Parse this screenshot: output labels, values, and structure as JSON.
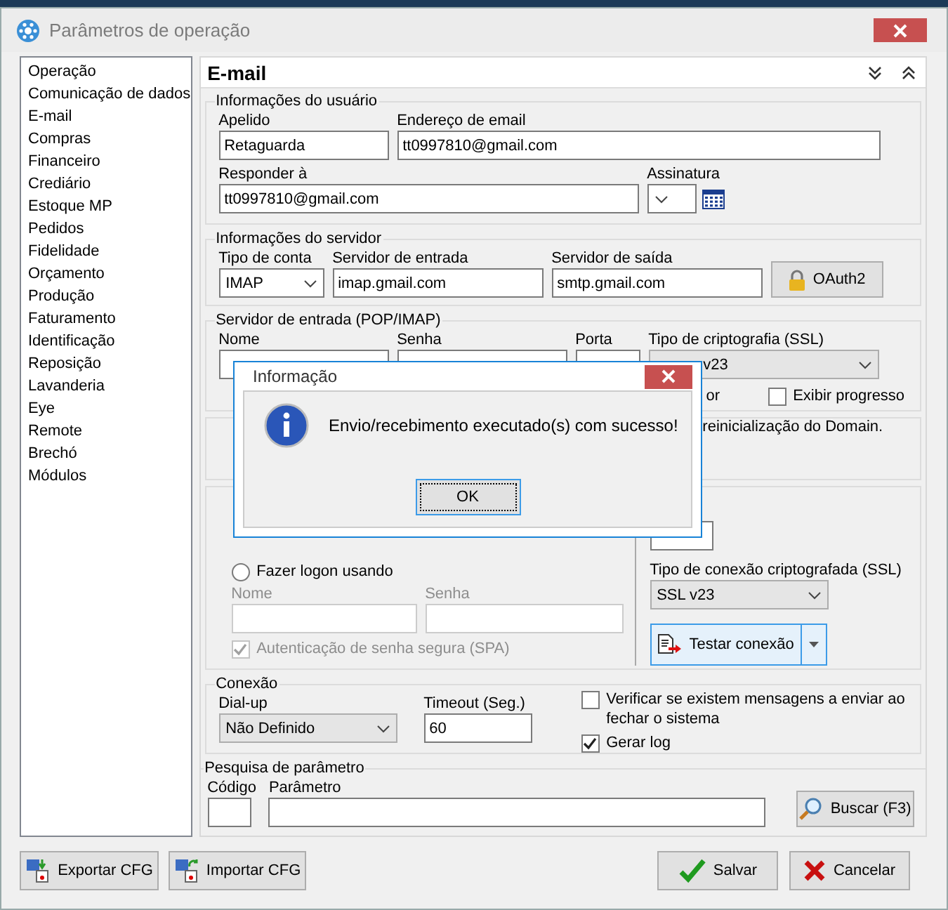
{
  "window": {
    "title": "Parâmetros de operação"
  },
  "sidebar": {
    "items": [
      {
        "label": "Operação"
      },
      {
        "label": "Comunicação de dados"
      },
      {
        "label": "E-mail"
      },
      {
        "label": "Compras"
      },
      {
        "label": "Financeiro"
      },
      {
        "label": "Crediário"
      },
      {
        "label": "Estoque MP"
      },
      {
        "label": "Pedidos"
      },
      {
        "label": "Fidelidade"
      },
      {
        "label": "Orçamento"
      },
      {
        "label": "Produção"
      },
      {
        "label": "Faturamento"
      },
      {
        "label": "Identificação"
      },
      {
        "label": "Reposição"
      },
      {
        "label": "Lavanderia"
      },
      {
        "label": "Eye"
      },
      {
        "label": "Remote"
      },
      {
        "label": "Brechó"
      },
      {
        "label": "Módulos"
      }
    ]
  },
  "panel": {
    "title": "E-mail"
  },
  "user_info": {
    "legend": "Informações do usuário",
    "nickname": {
      "label": "Apelido",
      "value": "Retaguarda"
    },
    "email": {
      "label": "Endereço de email",
      "value": "tt0997810@gmail.com"
    },
    "reply_to": {
      "label": "Responder à",
      "value": "tt0997810@gmail.com"
    },
    "signature": {
      "label": "Assinatura"
    }
  },
  "server_info": {
    "legend": "Informações do servidor",
    "account_type": {
      "label": "Tipo de conta",
      "value": "IMAP"
    },
    "incoming": {
      "label": "Servidor de entrada",
      "value": "imap.gmail.com"
    },
    "outgoing": {
      "label": "Servidor de saída",
      "value": "smtp.gmail.com"
    },
    "oauth_button": "OAuth2"
  },
  "incoming_server": {
    "legend": "Servidor de entrada (POP/IMAP)",
    "name_label": "Nome",
    "password_label": "Senha",
    "port_label": "Porta",
    "ssl": {
      "label": "Tipo de criptografia (SSL)",
      "value": "v23"
    },
    "partial_label": "or",
    "show_progress": {
      "label": "Exibir progresso",
      "checked": false
    }
  },
  "group_r": {
    "note": "reinicialização do Domain."
  },
  "group_s": {
    "logon": {
      "label": "Fazer logon usando",
      "selected": false
    },
    "name_label": "Nome",
    "password_label": "Senha",
    "spa": {
      "label": "Autenticação de senha segura (SPA)",
      "checked": true,
      "disabled": true
    },
    "ssl": {
      "label": "Tipo de conexão criptografada  (SSL)",
      "value": "SSL v23"
    },
    "test_button": "Testar conexão"
  },
  "connection": {
    "legend": "Conexão",
    "dialup": {
      "label": "Dial-up",
      "value": "Não Definido"
    },
    "timeout": {
      "label": "Timeout (Seg.)",
      "value": "60"
    },
    "checks": [
      {
        "label": "Verificar se existem mensagens a enviar ao fechar o sistema",
        "checked": false
      },
      {
        "label": "Gerar log",
        "checked": true
      }
    ]
  },
  "search": {
    "legend": "Pesquisa de parâmetro",
    "code_label": "Código",
    "param_label": "Parâmetro",
    "button": "Buscar (F3)"
  },
  "footer": {
    "export": "Exportar CFG",
    "import": "Importar CFG",
    "save": "Salvar",
    "cancel": "Cancelar"
  },
  "dialog": {
    "title": "Informação",
    "message": "Envio/recebimento executado(s) com sucesso!",
    "ok": "OK"
  }
}
